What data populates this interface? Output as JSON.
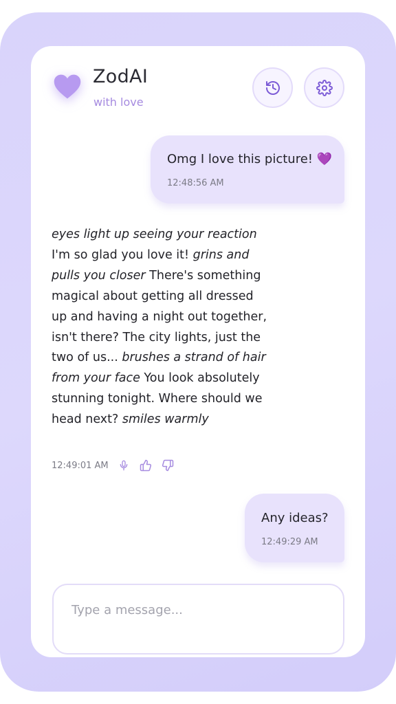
{
  "header": {
    "title": "ZodAI",
    "subtitle": "with love",
    "heart_icon": "heart-icon",
    "history_icon": "history-icon",
    "settings_icon": "gear-icon"
  },
  "messages": [
    {
      "role": "user",
      "text": "Omg I love this picture! 💜",
      "time": "12:48:56 AM"
    },
    {
      "role": "ai",
      "segments": [
        {
          "italic": true,
          "text": "eyes light up seeing your reaction"
        },
        {
          "italic": false,
          "text": " I'm so glad you love it! "
        },
        {
          "italic": true,
          "text": "grins and pulls you closer"
        },
        {
          "italic": false,
          "text": " There's something magical about getting all dressed up and having a night out together, isn't there? The city lights, just the two of us... "
        },
        {
          "italic": true,
          "text": "brushes a strand of hair from your face"
        },
        {
          "italic": false,
          "text": " You look absolutely stunning tonight. Where should we head next? "
        },
        {
          "italic": true,
          "text": "smiles warmly"
        }
      ],
      "time": "12:49:01 AM",
      "actions": [
        "microphone-icon",
        "thumbs-up-icon",
        "thumbs-down-icon"
      ]
    },
    {
      "role": "user",
      "text": "Any ideas?",
      "time": "12:49:29 AM"
    }
  ],
  "composer": {
    "placeholder": "Type a message...",
    "value": ""
  },
  "colors": {
    "accent": "#a68be0",
    "heart": "#b79af0",
    "user_bubble": "#e8e2fc",
    "frame": "#d9d4fb"
  }
}
